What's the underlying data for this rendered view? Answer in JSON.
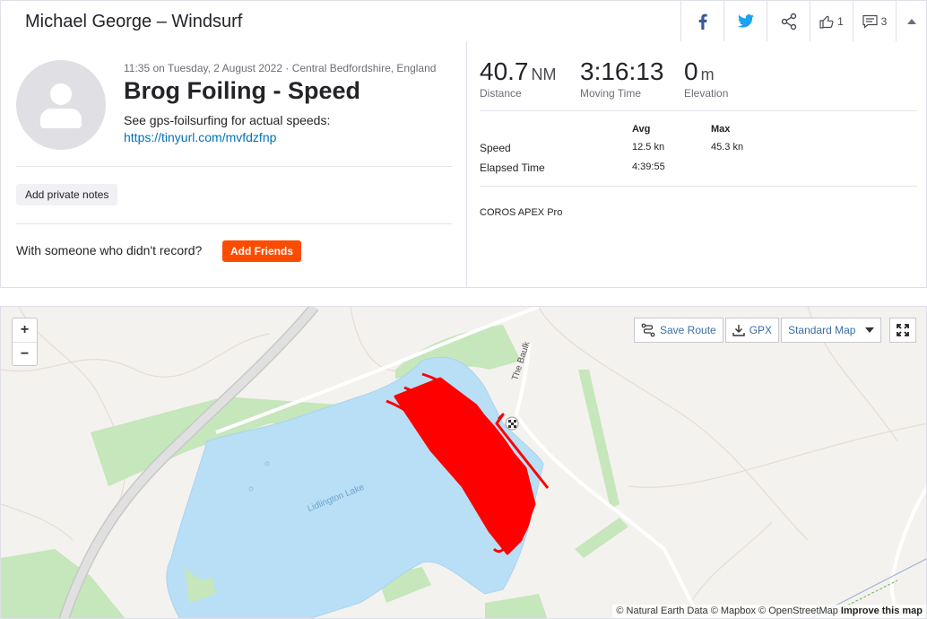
{
  "header": {
    "title": "Michael George – Windsurf",
    "kudos_count": "1",
    "comment_count": "3"
  },
  "activity": {
    "meta": "11:35 on Tuesday, 2 August 2022 · Central Bedfordshire, England",
    "title": "Brog Foiling - Speed",
    "description": "See gps-foilsurfing for actual speeds:",
    "link": "https://tinyurl.com/mvfdzfnp",
    "add_notes_label": "Add private notes",
    "friends_prompt": "With someone who didn't record?",
    "add_friends_label": "Add Friends"
  },
  "stats": {
    "distance_value": "40.7",
    "distance_unit": "NM",
    "distance_label": "Distance",
    "moving_time_value": "3:16:13",
    "moving_time_label": "Moving Time",
    "elevation_value": "0",
    "elevation_unit": "m",
    "elevation_label": "Elevation",
    "col_avg": "Avg",
    "col_max": "Max",
    "speed_label": "Speed",
    "speed_avg": "12.5 kn",
    "speed_max": "45.3 kn",
    "elapsed_label": "Elapsed Time",
    "elapsed_avg": "4:39:55",
    "device": "COROS APEX Pro"
  },
  "map": {
    "zoom_in": "+",
    "zoom_out": "−",
    "save_route_label": "Save Route",
    "gpx_label": "GPX",
    "map_type_label": "Standard Map",
    "lake_label": "Lidlington Lake",
    "road_label": "The Baulk",
    "attribution": "© Natural Earth Data © Mapbox © OpenStreetMap",
    "improve_label": "Improve this map",
    "colors": {
      "water": "#b9dff7",
      "park": "#c6e6bb",
      "track": "#ff0000",
      "land": "#f4f2ee"
    }
  },
  "colors": {
    "accent": "#fc4c02",
    "link": "#0072b6",
    "facebook": "#3b5998",
    "twitter": "#1da1f2"
  }
}
